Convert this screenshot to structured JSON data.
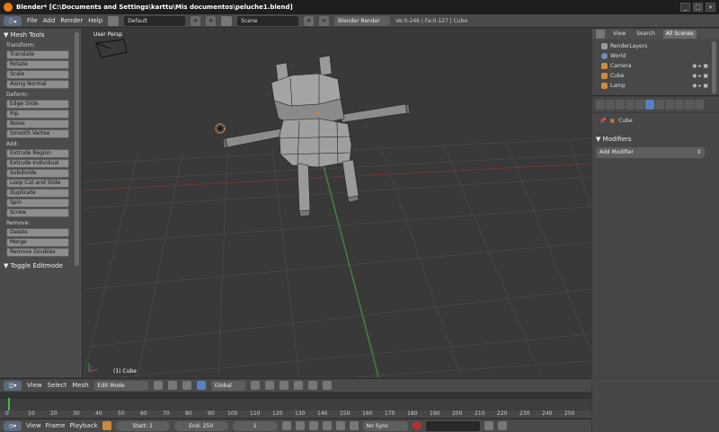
{
  "window": {
    "title": "Blender* [C:\\Documents and Settings\\karttu\\Mis documentos\\peluche1.blend]",
    "controls": [
      "_",
      "□",
      "×"
    ]
  },
  "info_header": {
    "menus": [
      "File",
      "Add",
      "Render",
      "Help"
    ],
    "screen_layout": "Default",
    "scene": "Scene",
    "render_engine": "Blender Render",
    "stats": "Ve:0-246 | Fa:0-127 | Cube"
  },
  "toolshelf": {
    "title": "Mesh Tools",
    "groups": [
      {
        "label": "Transform:",
        "buttons": [
          "Translate",
          "Rotate",
          "Scale",
          "Along Normal"
        ]
      },
      {
        "label": "Deform:",
        "buttons": [
          "Edge Slide",
          "Rip",
          "Noise",
          "Smooth Vertex"
        ]
      },
      {
        "label": "Add:",
        "buttons": [
          "Extrude Region",
          "Extrude Individual",
          "Subdivide",
          "Loop Cut and Slide",
          "Duplicate",
          "Spin",
          "Screw"
        ]
      },
      {
        "label": "Remove:",
        "buttons": [
          "Delete",
          "Merge",
          "Remove Doubles"
        ]
      }
    ],
    "toggle_panel": "Toggle Editmode"
  },
  "viewport": {
    "view_name": "User Persp",
    "object_label": "(1) Cube"
  },
  "outliner": {
    "tabs": [
      "View",
      "Search",
      "All Scenes"
    ],
    "active_tab": "All Scenes",
    "rows": [
      {
        "label": "RenderLayers",
        "icon_color": "#9a9a9a"
      },
      {
        "label": "World",
        "icon_color": "#6a8fbf"
      },
      {
        "label": "Camera",
        "icon_color": "#d08a3c"
      },
      {
        "label": "Cube",
        "icon_color": "#d08a3c"
      },
      {
        "label": "Lamp",
        "icon_color": "#d08a3c"
      }
    ]
  },
  "properties": {
    "context_object": "Cube",
    "section_title": "Modifiers",
    "add_modifier": "Add Modifier"
  },
  "view3d_header": {
    "menus": [
      "View",
      "Select",
      "Mesh"
    ],
    "mode": "Edit Mode",
    "orientation": "Global"
  },
  "timeline": {
    "ticks": [
      "0",
      "10",
      "20",
      "30",
      "40",
      "50",
      "60",
      "70",
      "80",
      "90",
      "100",
      "110",
      "120",
      "130",
      "140",
      "150",
      "160",
      "170",
      "180",
      "190",
      "200",
      "210",
      "220",
      "230",
      "240",
      "250"
    ],
    "current_frame_marker": "0"
  },
  "playback": {
    "menus": [
      "View",
      "Frame",
      "Playback"
    ],
    "start": "Start: 1",
    "end": "End: 250",
    "current": "1",
    "sync": "No Sync"
  },
  "colors": {
    "accent": "#5680c2",
    "blender_orange": "#e87d0d",
    "selected_mesh": "#d8a030",
    "x_axis": "#a03838",
    "y_axis": "#3f9f3f"
  }
}
